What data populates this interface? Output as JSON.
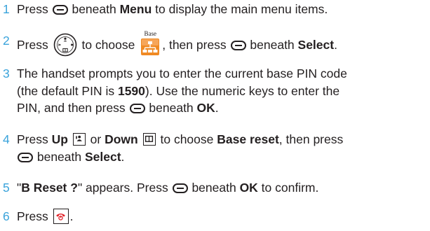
{
  "steps": [
    {
      "num": "1",
      "t1": "Press ",
      "t2": " beneath ",
      "b1": "Menu",
      "t3": " to display the main menu items."
    },
    {
      "num": "2",
      "t1": "Press ",
      "t2": " to choose ",
      "t3": ", then press ",
      "t4": " beneath ",
      "b1": "Select",
      "t5": ".",
      "base_icon_label": "Base"
    },
    {
      "num": "3",
      "line1": "The handset prompts you to enter the current base PIN code",
      "l2a": "(the default PIN is ",
      "b1": "1590",
      "l2b": "). Use the numeric keys to enter the",
      "l3a": "PIN, and then press ",
      "l3b": " beneath ",
      "b2": "OK",
      "l3c": "."
    },
    {
      "num": "4",
      "l1a": "Press ",
      "b1": "Up",
      "l1b": " or ",
      "b2": "Down",
      "l1c": " to choose ",
      "b3": "Base reset",
      "l1d": ", then press",
      "l2a": " beneath ",
      "b4": "Select",
      "l2b": "."
    },
    {
      "num": "5",
      "q1": "\"",
      "b1": "B Reset ?",
      "q2": "\"",
      "t1": " appears. Press ",
      "t2": " beneath ",
      "b2": "OK",
      "t3": " to confirm."
    },
    {
      "num": "6",
      "t1": "Press ",
      "t2": "."
    }
  ],
  "colors": {
    "step_number": "#3aa3db",
    "text": "#231f20",
    "base_icon_orange": "#f08a24",
    "end_key_red": "#e2232a"
  },
  "icons": {
    "soft_key": "softkey-icon",
    "nav_pad": "navigation-key-icon",
    "base_menu": "base-menu-icon",
    "up_key": "up-key-icon",
    "down_key": "down-key-icon",
    "end_key": "end-call-key-icon"
  }
}
